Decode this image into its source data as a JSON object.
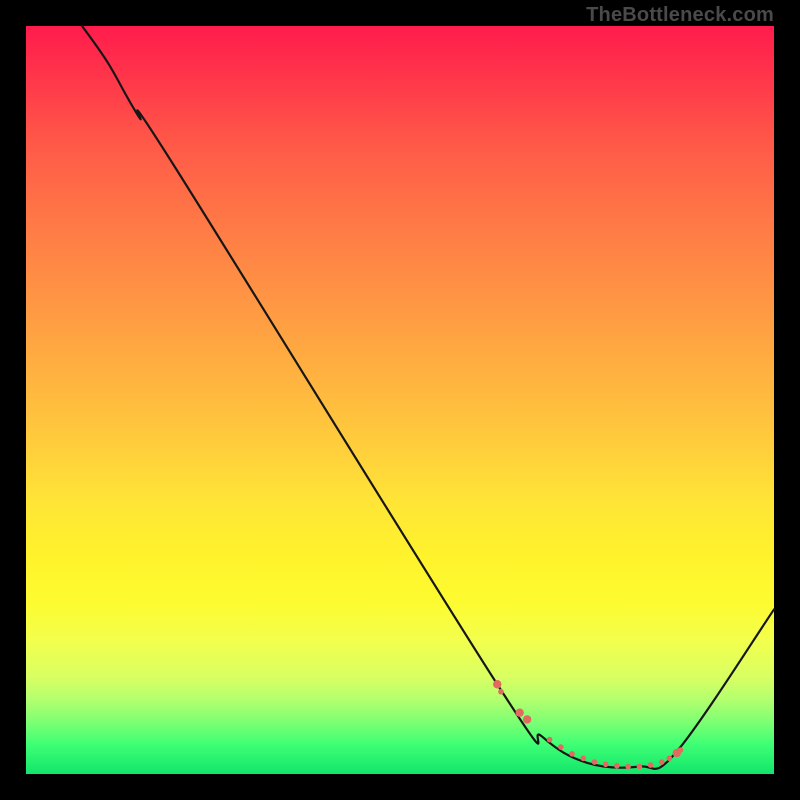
{
  "attribution": "TheBottleneck.com",
  "chart_data": {
    "type": "line",
    "title": "",
    "xlabel": "",
    "ylabel": "",
    "xlim": [
      0,
      100
    ],
    "ylim": [
      0,
      100
    ],
    "series": [
      {
        "name": "curve",
        "x": [
          7.5,
          11,
          15,
          20,
          63,
          69,
          75,
          82,
          87,
          100
        ],
        "y": [
          100,
          95,
          88,
          81,
          12,
          5,
          1.5,
          1,
          3,
          22
        ]
      }
    ],
    "markers": {
      "name": "highlight-points",
      "color": "#e36a60",
      "x": [
        63,
        63.5,
        66,
        67,
        70,
        71.5,
        73,
        74.5,
        76,
        77.5,
        79,
        80.5,
        82,
        83.5,
        85,
        86,
        87,
        87.5
      ],
      "y": [
        12,
        11,
        8.2,
        7.3,
        4.6,
        3.6,
        2.7,
        2.1,
        1.6,
        1.3,
        1.1,
        1.0,
        1.0,
        1.2,
        1.6,
        2.1,
        2.8,
        3.2
      ],
      "r": [
        4.2,
        2.8,
        4.2,
        4.2,
        2.8,
        2.8,
        2.8,
        2.8,
        2.8,
        2.8,
        2.8,
        2.8,
        2.8,
        2.8,
        2.8,
        2.8,
        4.2,
        2.8
      ]
    }
  }
}
